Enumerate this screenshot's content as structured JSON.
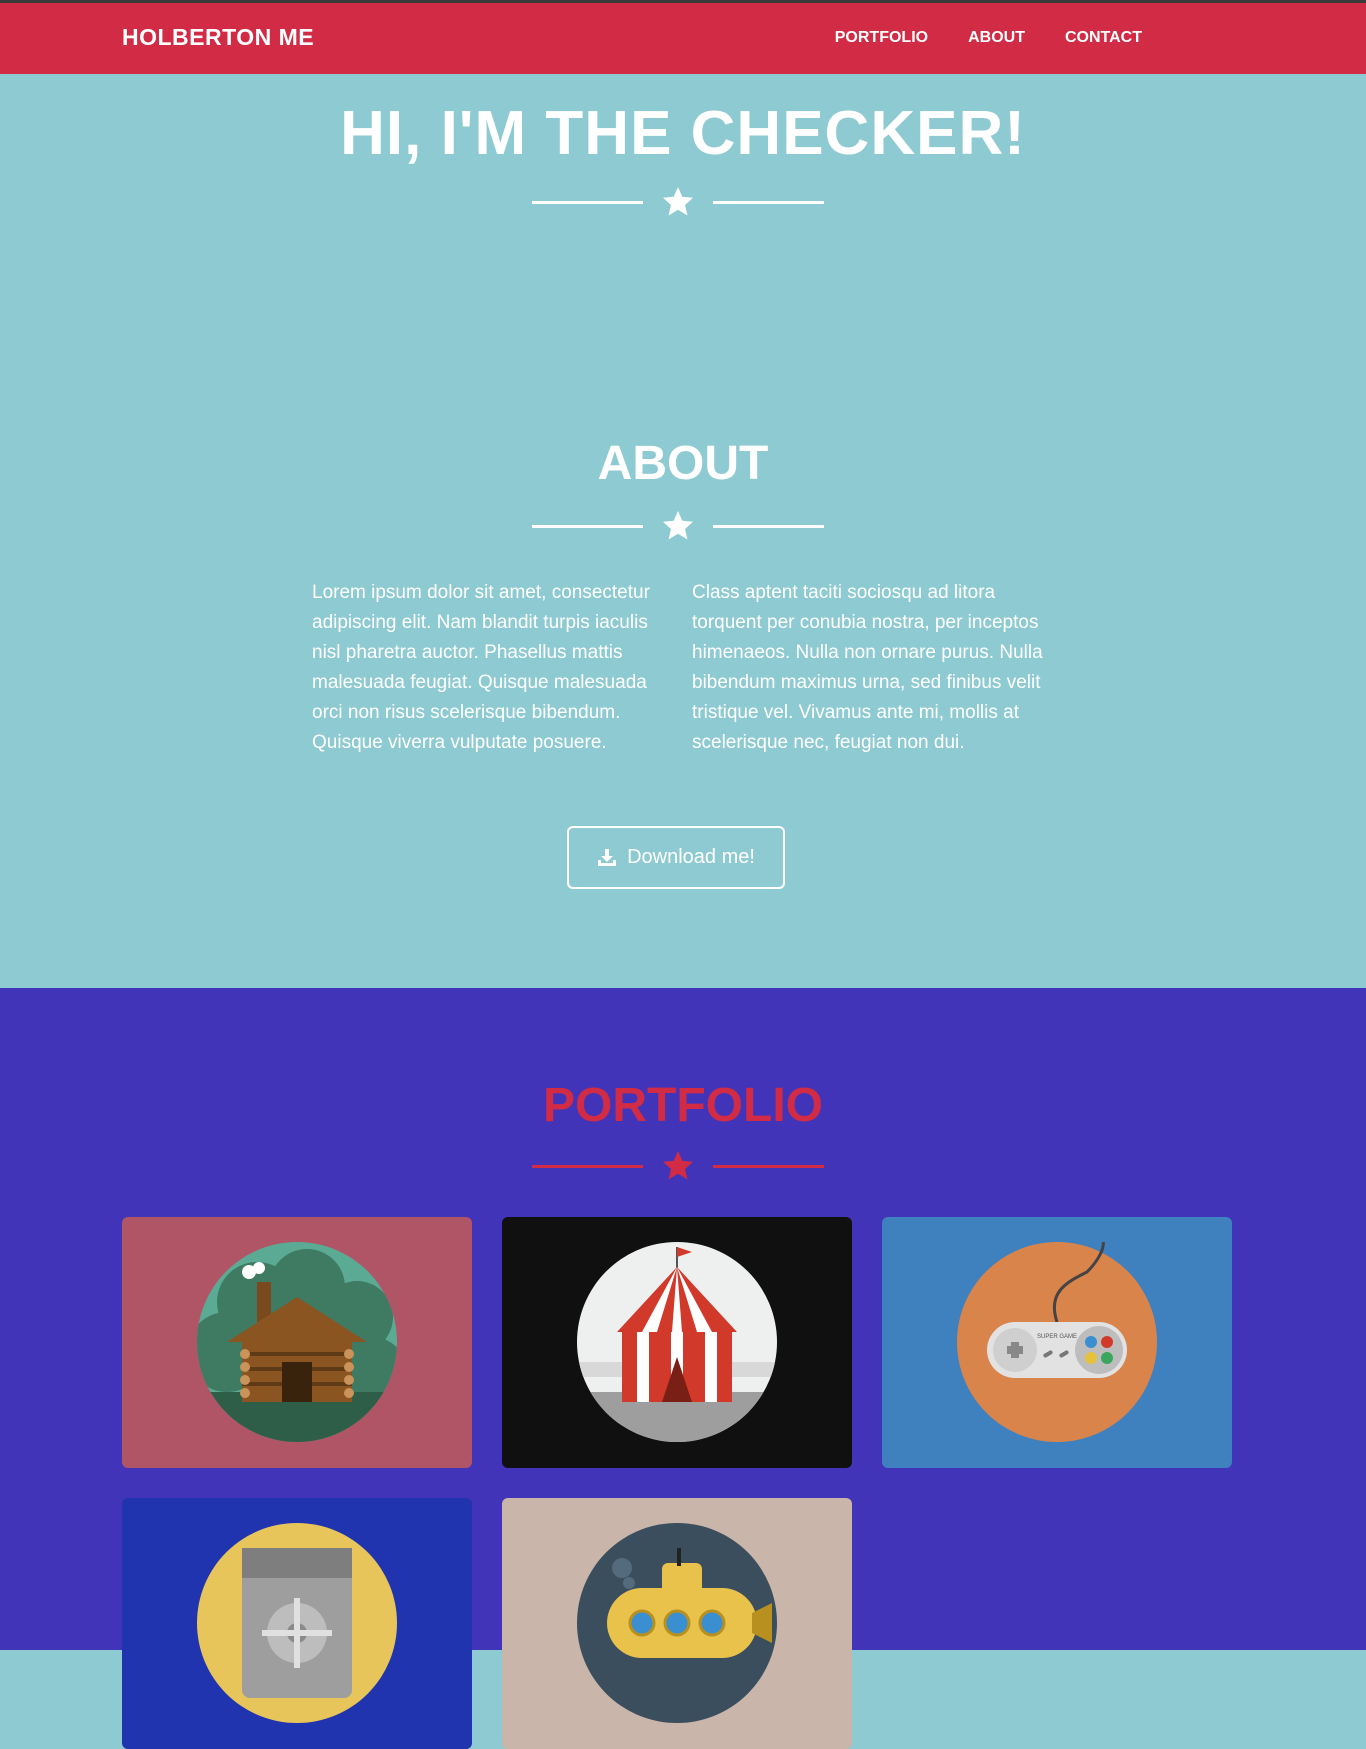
{
  "nav": {
    "brand": "HOLBERTON ME",
    "links": [
      "PORTFOLIO",
      "ABOUT",
      "CONTACT"
    ]
  },
  "hero": {
    "title": "HI, I'M THE CHECKER!"
  },
  "about": {
    "title": "ABOUT",
    "col1": "Lorem ipsum dolor sit amet, consectetur adipiscing elit. Nam blandit turpis iaculis nisl pharetra auctor. Phasellus mattis malesuada feugiat. Quisque malesuada orci non risus scelerisque bibendum. Quisque viverra vulputate posuere.",
    "col2": "Class aptent taciti sociosqu ad litora torquent per conubia nostra, per inceptos himenaeos. Nulla non ornare purus. Nulla bibendum maximus urna, sed finibus velit tristique vel. Vivamus ante mi, mollis at scelerisque nec, feugiat non dui.",
    "button_label": "Download me!",
    "button_icon": "download-icon"
  },
  "portfolio": {
    "title": "PORTFOLIO",
    "items": [
      {
        "icon": "log-cabin-icon",
        "bg": "#b05566"
      },
      {
        "icon": "circus-tent-icon",
        "bg": "#101010"
      },
      {
        "icon": "game-controller-icon",
        "bg": "#3f80bf",
        "label": "SUPER GAME"
      },
      {
        "icon": "safe-icon",
        "bg": "#1f34ae"
      },
      {
        "icon": "submarine-icon",
        "bg": "#c9b5a9"
      }
    ]
  },
  "colors": {
    "navbar": "#d12b45",
    "about_bg": "#8ecad1",
    "portfolio_bg": "#4134b8",
    "accent": "#d12b45",
    "text_light": "#ffffff"
  }
}
